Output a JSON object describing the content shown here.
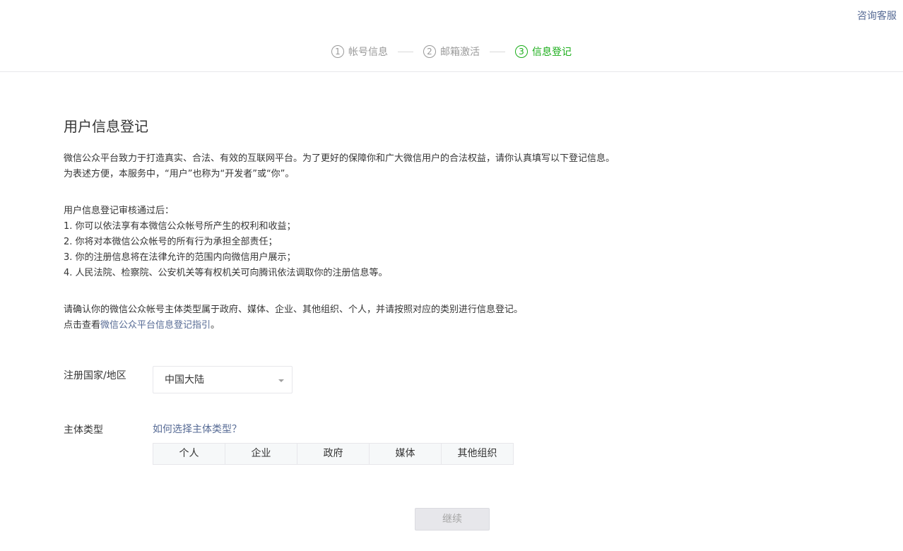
{
  "header": {
    "service_link": "咨询客服",
    "steps": [
      {
        "num": "1",
        "label": "帐号信息",
        "state": "done"
      },
      {
        "num": "2",
        "label": "邮箱激活",
        "state": "done"
      },
      {
        "num": "3",
        "label": "信息登记",
        "state": "active"
      }
    ],
    "active_color": "#1aad19"
  },
  "main": {
    "title": "用户信息登记",
    "intro": [
      "微信公众平台致力于打造真实、合法、有效的互联网平台。为了更好的保障你和广大微信用户的合法权益，请你认真填写以下登记信息。",
      "为表述方便，本服务中，“用户”也称为“开发者”或“你”。"
    ],
    "after_review": {
      "heading": "用户信息登记审核通过后：",
      "items": [
        "1. 你可以依法享有本微信公众帐号所产生的权利和收益；",
        "2. 你将对本微信公众帐号的所有行为承担全部责任；",
        "3. 你的注册信息将在法律允许的范围内向微信用户展示；",
        "4. 人民法院、检察院、公安机关等有权机关可向腾讯依法调取你的注册信息等。"
      ]
    },
    "confirm": {
      "line1": "请确认你的微信公众帐号主体类型属于政府、媒体、企业、其他组织、个人，并请按照对应的类别进行信息登记。",
      "line2_prefix": "点击查看",
      "guide_link": "微信公众平台信息登记指引",
      "line2_suffix": "。"
    },
    "country": {
      "label": "注册国家/地区",
      "selected": "中国大陆"
    },
    "subject": {
      "label": "主体类型",
      "help_link": "如何选择主体类型？",
      "options": [
        "个人",
        "企业",
        "政府",
        "媒体",
        "其他组织"
      ]
    },
    "continue_label": "继续",
    "link_color": "#576b95"
  }
}
